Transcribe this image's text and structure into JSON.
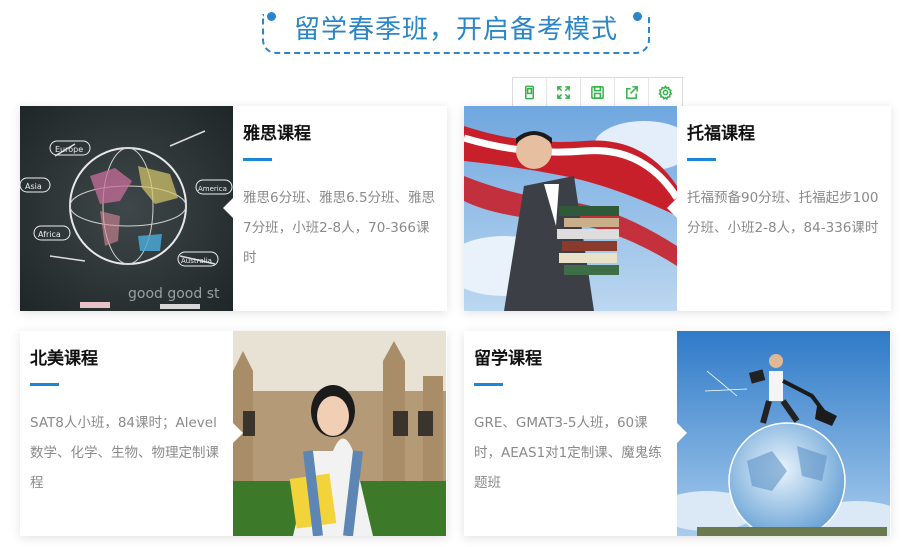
{
  "heading": "留学春季班，开启备考模式",
  "toolbar": {
    "icons": [
      "mobile-icon",
      "fullscreen-icon",
      "save-icon",
      "share-icon",
      "settings-icon"
    ]
  },
  "cards": [
    {
      "title": "雅思课程",
      "desc": "雅思6分班、雅思6.5分班、雅思7分班，小班2-8人，70-366课时",
      "image": "chalkboard-globe"
    },
    {
      "title": "托福课程",
      "desc": "托福预备90分班、托福起步100分班、小班2-8人，84-336课时",
      "image": "man-with-books-flag"
    },
    {
      "title": "北美课程",
      "desc": "SAT8人小班，84课时；Alevel数学、化学、生物、物理定制课程",
      "image": "student-at-university"
    },
    {
      "title": "留学课程",
      "desc": "GRE、GMAT3-5人班，60课时，AEAS1对1定制课、魔鬼练题班",
      "image": "businessman-on-globe"
    }
  ],
  "colors": {
    "accent": "#2a86c9",
    "bar": "#1a88d8",
    "tool_icon": "#33b24a"
  }
}
